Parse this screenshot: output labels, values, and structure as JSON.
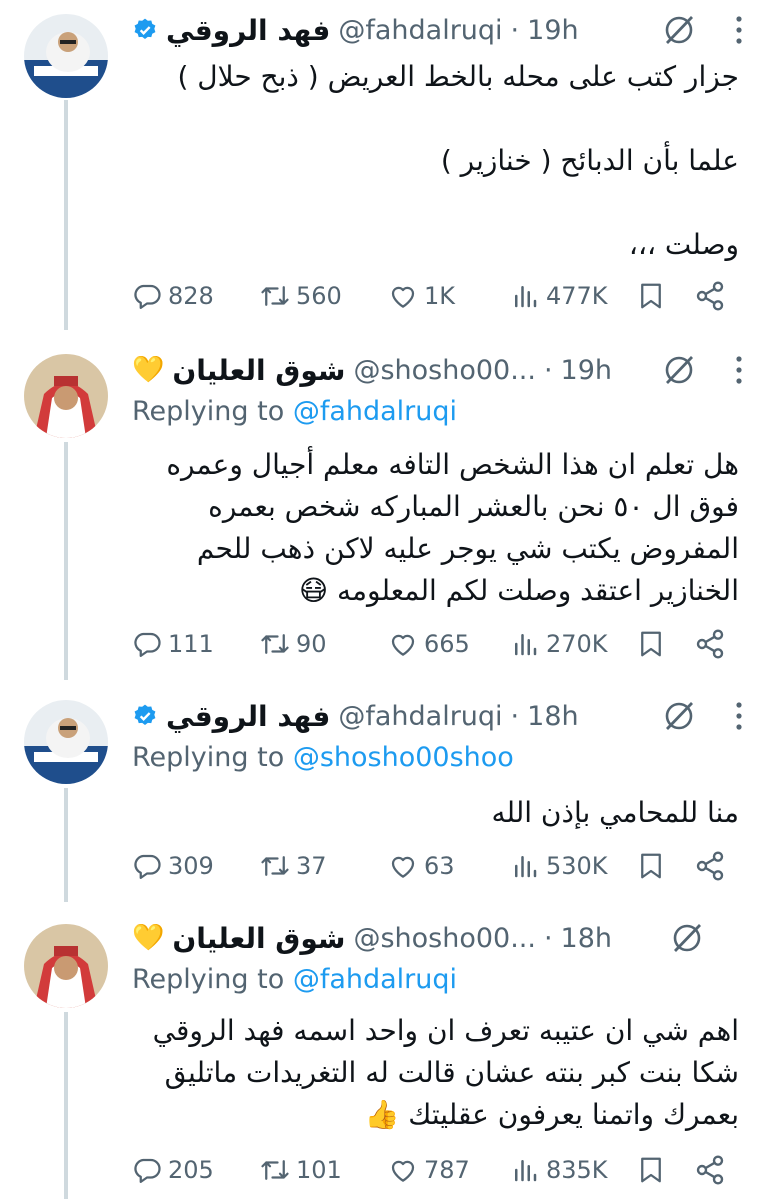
{
  "tweets": [
    {
      "display_name": "فهد الروقي",
      "handle": "@fahdalruqi",
      "dot": "·",
      "time": "19h",
      "verified": true,
      "emoji": "",
      "reply_prefix": "",
      "reply_to": "",
      "text": "جزار كتب على محله بالخط العريض ( ذبح حلال )\n\nعلما بأن الدبائح ( خنازير )\n\nوصلت ،،،",
      "stats": {
        "replies": "828",
        "retweets": "560",
        "likes": "1K",
        "views": "477K"
      }
    },
    {
      "display_name": "شوق العليان",
      "handle": "@shosho00...",
      "dot": "·",
      "time": "19h",
      "verified": false,
      "emoji": "💛",
      "reply_prefix": "Replying to ",
      "reply_to": "@fahdalruqi",
      "text": "هل تعلم ان هذا الشخص التافه معلم أجيال وعمره فوق ال ٥٠ نحن بالعشر المباركه شخص بعمره المفروض يكتب شي يوجر عليه لاكن ذهب للحم الخنازير اعتقد وصلت لكم المعلومه 😷",
      "stats": {
        "replies": "111",
        "retweets": "90",
        "likes": "665",
        "views": "270K"
      }
    },
    {
      "display_name": "فهد الروقي",
      "handle": "@fahdalruqi",
      "dot": "·",
      "time": "18h",
      "verified": true,
      "emoji": "",
      "reply_prefix": "Replying to ",
      "reply_to": "@shosho00shoo",
      "text": "منا للمحامي بإذن الله",
      "stats": {
        "replies": "309",
        "retweets": "37",
        "likes": "63",
        "views": "530K"
      }
    },
    {
      "display_name": "شوق العليان",
      "handle": "@shosho00...",
      "dot": "·",
      "time": "18h",
      "verified": false,
      "emoji": "💛",
      "reply_prefix": "Replying to ",
      "reply_to": "@fahdalruqi",
      "text": "اهم شي ان عتيبه تعرف ان واحد اسمه فهد الروقي شكا بنت كبر بنته عشان قالت له التغريدات ماتليق بعمرك واتمنا يعرفون عقليتك 👍",
      "stats": {
        "replies": "205",
        "retweets": "101",
        "likes": "787",
        "views": "835K"
      }
    }
  ],
  "icons": {
    "avatar": "profile-photo",
    "verified": "verified-badge-icon",
    "grok": "grok-icon",
    "more": "more-icon",
    "reply": "reply-icon",
    "retweet": "retweet-icon",
    "like": "heart-icon",
    "views": "views-icon",
    "bookmark": "bookmark-icon",
    "share": "share-icon"
  },
  "colors": {
    "link": "#1d9bf0",
    "muted": "#536471",
    "verified": "#1d9bf0",
    "text": "#0f1419"
  }
}
